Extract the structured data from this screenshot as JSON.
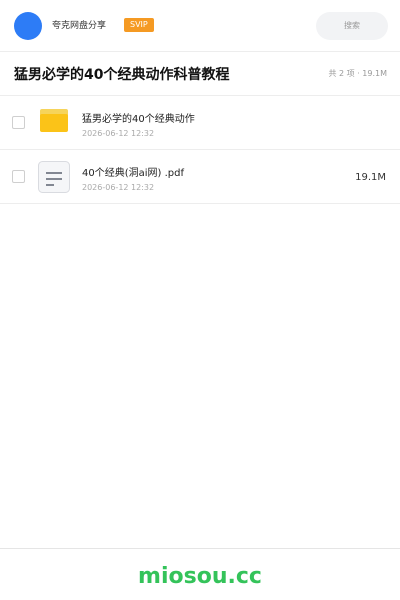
{
  "header": {
    "brand": "夸克网盘分享",
    "badge": "SVIP",
    "search_label": "搜索"
  },
  "share": {
    "title": "猛男必学的40个经典动作科普教程",
    "summary": "共 2 项 · 19.1M"
  },
  "files": [
    {
      "name": "猛男必学的40个经典动作",
      "date": "2026-06-12 12:32",
      "size": "",
      "icon": "folder-icon"
    },
    {
      "name": "40个经典(洞ai网) .pdf",
      "date": "2026-06-12 12:32",
      "size": "19.1M",
      "icon": "document-icon"
    }
  ],
  "footer": {
    "site": "miosou.cc"
  },
  "colors": {
    "avatar": "#2d7cf6",
    "badge": "#f59a23",
    "folder": "#fbc318",
    "site": "#34c35a"
  }
}
